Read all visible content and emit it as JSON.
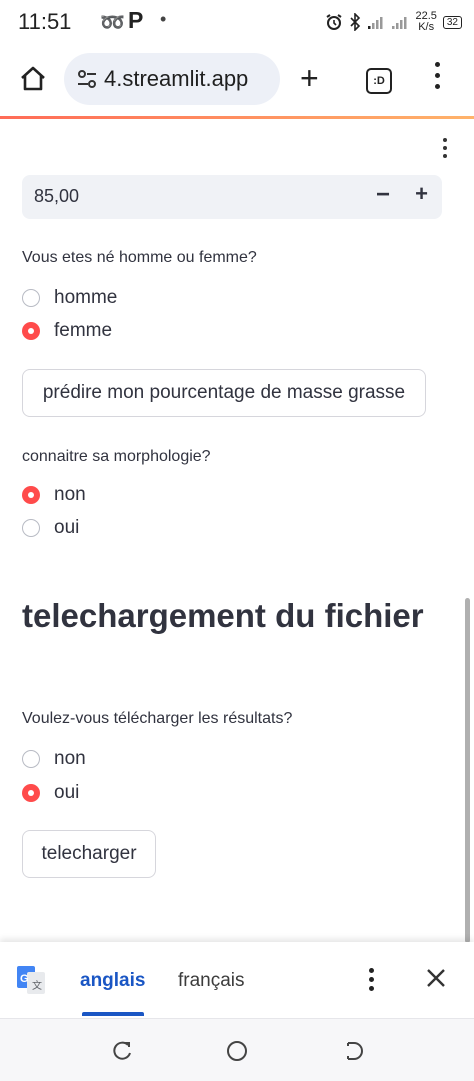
{
  "status_bar": {
    "time": "11:51",
    "network_speed_value": "22.5",
    "network_speed_unit": "K/s",
    "battery": "32",
    "icons": [
      "at-icon",
      "p-icon",
      "dot-icon",
      "alarm-icon",
      "bluetooth-icon",
      "signal-icon",
      "signal2-icon",
      "battery-icon"
    ]
  },
  "browser": {
    "url": "4.streamlit.app",
    "tabs_count_label": ":D"
  },
  "app": {
    "number_input": {
      "value": "85,00",
      "minus": "−",
      "plus": "+"
    },
    "sex_question": "Vous etes né homme ou femme?",
    "sex_options": [
      "homme",
      "femme"
    ],
    "sex_selected": "femme",
    "predict_button": "prédire mon pourcentage de masse grasse",
    "morpho_question": "connaitre sa morphologie?",
    "morpho_options": [
      "non",
      "oui"
    ],
    "morpho_selected": "non",
    "download_heading": "telechargement du fichier",
    "download_question": "Voulez-vous télécharger les résultats?",
    "download_options": [
      "non",
      "oui"
    ],
    "download_selected": "oui",
    "download_button": "telecharger"
  },
  "translate_bar": {
    "source_language": "anglais",
    "target_language": "français"
  },
  "colors": {
    "accent_red": "#ff4b4b",
    "translate_blue": "#1a56c4"
  }
}
